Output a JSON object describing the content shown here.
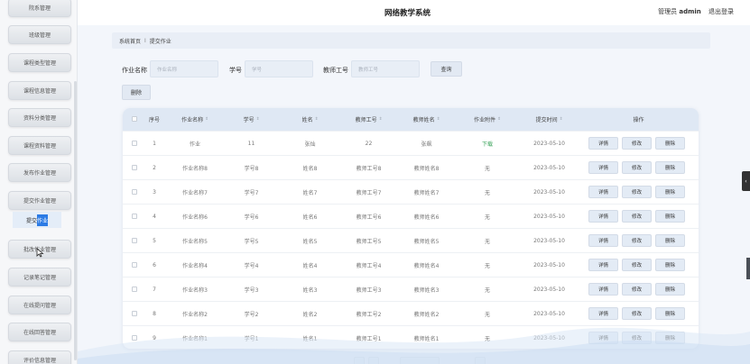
{
  "header": {
    "title": "网络教学系统",
    "role": "管理员",
    "username": "admin",
    "logout": "退出登录"
  },
  "sidebar": {
    "items": [
      "院系管理",
      "班级管理",
      "课程类型管理",
      "课程信息管理",
      "资料分类管理",
      "课程资料管理",
      "发布作业管理",
      "提交作业管理",
      "批改作业管理",
      "记录笔记管理",
      "在线提问管理",
      "在线回答管理",
      "评价信息管理"
    ],
    "sub_item_prefix": "提交",
    "sub_item_highlight": "作业"
  },
  "breadcrumb": {
    "home": "系统首页",
    "sep": "I",
    "current": "提交作业"
  },
  "search": {
    "fields": [
      {
        "label": "作业名称",
        "placeholder": "作业名称"
      },
      {
        "label": "学号",
        "placeholder": "学号"
      },
      {
        "label": "教师工号",
        "placeholder": "教师工号"
      }
    ],
    "query_button": "查询",
    "delete_button": "删除"
  },
  "table": {
    "columns": [
      "序号",
      "作业名称",
      "学号",
      "姓名",
      "教师工号",
      "教师姓名",
      "作业附件",
      "提交时间",
      "操作"
    ],
    "rows": [
      {
        "no": "1",
        "name": "作业",
        "sid": "11",
        "sname": "张灿",
        "tid": "22",
        "tname": "张飙",
        "file": "下载",
        "time": "2023-05-10"
      },
      {
        "no": "2",
        "name": "作业名称8",
        "sid": "学号8",
        "sname": "姓名8",
        "tid": "教师工号8",
        "tname": "教师姓名8",
        "file": "无",
        "time": "2023-05-10"
      },
      {
        "no": "3",
        "name": "作业名称7",
        "sid": "学号7",
        "sname": "姓名7",
        "tid": "教师工号7",
        "tname": "教师姓名7",
        "file": "无",
        "time": "2023-05-10"
      },
      {
        "no": "4",
        "name": "作业名称6",
        "sid": "学号6",
        "sname": "姓名6",
        "tid": "教师工号6",
        "tname": "教师姓名6",
        "file": "无",
        "time": "2023-05-10"
      },
      {
        "no": "5",
        "name": "作业名称5",
        "sid": "学号5",
        "sname": "姓名5",
        "tid": "教师工号5",
        "tname": "教师姓名5",
        "file": "无",
        "time": "2023-05-10"
      },
      {
        "no": "6",
        "name": "作业名称4",
        "sid": "学号4",
        "sname": "姓名4",
        "tid": "教师工号4",
        "tname": "教师姓名4",
        "file": "无",
        "time": "2023-05-10"
      },
      {
        "no": "7",
        "name": "作业名称3",
        "sid": "学号3",
        "sname": "姓名3",
        "tid": "教师工号3",
        "tname": "教师姓名3",
        "file": "无",
        "time": "2023-05-10"
      },
      {
        "no": "8",
        "name": "作业名称2",
        "sid": "学号2",
        "sname": "姓名2",
        "tid": "教师工号2",
        "tname": "教师姓名2",
        "file": "无",
        "time": "2023-05-10"
      },
      {
        "no": "9",
        "name": "作业名称1",
        "sid": "学号1",
        "sname": "姓名1",
        "tid": "教师工号1",
        "tname": "教师姓名1",
        "file": "无",
        "time": "2023-05-10"
      }
    ],
    "actions": [
      "详情",
      "修改",
      "删除"
    ]
  },
  "colors": {
    "download_link": "#3aa35a",
    "accent": "#2c7be5",
    "header_row": "#dfe8f4"
  }
}
